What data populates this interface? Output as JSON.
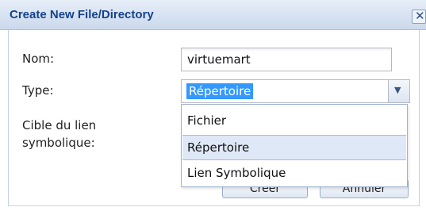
{
  "dialog": {
    "title": "Create New File/Directory",
    "close_glyph": "✕"
  },
  "form": {
    "name_label": "Nom:",
    "name_value": "virtuemart",
    "type_label": "Type:",
    "type_value": "Répertoire",
    "symlink_label_line1": "Cible du lien",
    "symlink_label_line2": "symbolique:"
  },
  "type_options": [
    "Fichier",
    "Répertoire",
    "Lien Symbolique"
  ],
  "buttons": {
    "create": "Créer",
    "cancel": "Annuler"
  },
  "icons": {
    "close": "close-icon",
    "dropdown": "chevron-down-icon"
  }
}
